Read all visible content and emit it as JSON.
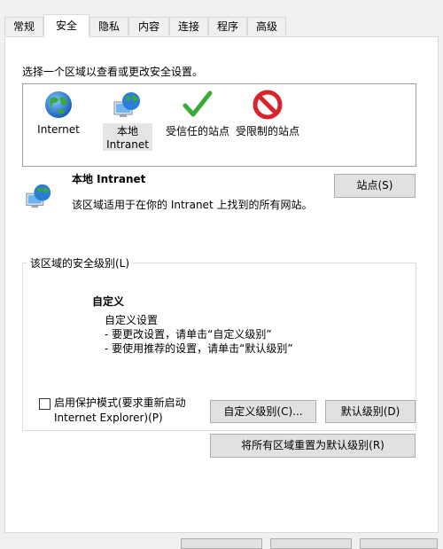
{
  "tabs": [
    "常规",
    "安全",
    "隐私",
    "内容",
    "连接",
    "程序",
    "高级"
  ],
  "active_tab": "安全",
  "select_zone_prompt": "选择一个区域以查看或更改安全设置。",
  "zones": [
    {
      "line1": "Internet",
      "line2": "",
      "icon": "globe-icon"
    },
    {
      "line1": "本地",
      "line2": "Intranet",
      "icon": "intranet-icon"
    },
    {
      "line1": "受信任的站点",
      "line2": "",
      "icon": "checkmark-icon"
    },
    {
      "line1": "受限制的站点",
      "line2": "",
      "icon": "restricted-icon"
    }
  ],
  "selected_zone": {
    "title": "本地 Intranet",
    "description": "该区域适用于在你的 Intranet 上找到的所有网站。",
    "sites_button": "站点(S)"
  },
  "security_level": {
    "group_label": "该区域的安全级别(L)",
    "level_title": "自定义",
    "lines": [
      "自定义设置",
      "- 要更改设置，请单击“自定义级别”",
      "- 要使用推荐的设置，请单击“默认级别”"
    ],
    "protected_mode_line1": "启用保护模式(要求重新启动",
    "protected_mode_line2": "Internet Explorer)(P)",
    "protected_mode_checked": false,
    "custom_level_button": "自定义级别(C)...",
    "default_level_button": "默认级别(D)"
  },
  "reset_all_button": "将所有区域重置为默认级别(R)",
  "colors": {
    "accent_green": "#3aa935",
    "restricted_red": "#d9232a",
    "globe_blue": "#2a7fd4"
  }
}
